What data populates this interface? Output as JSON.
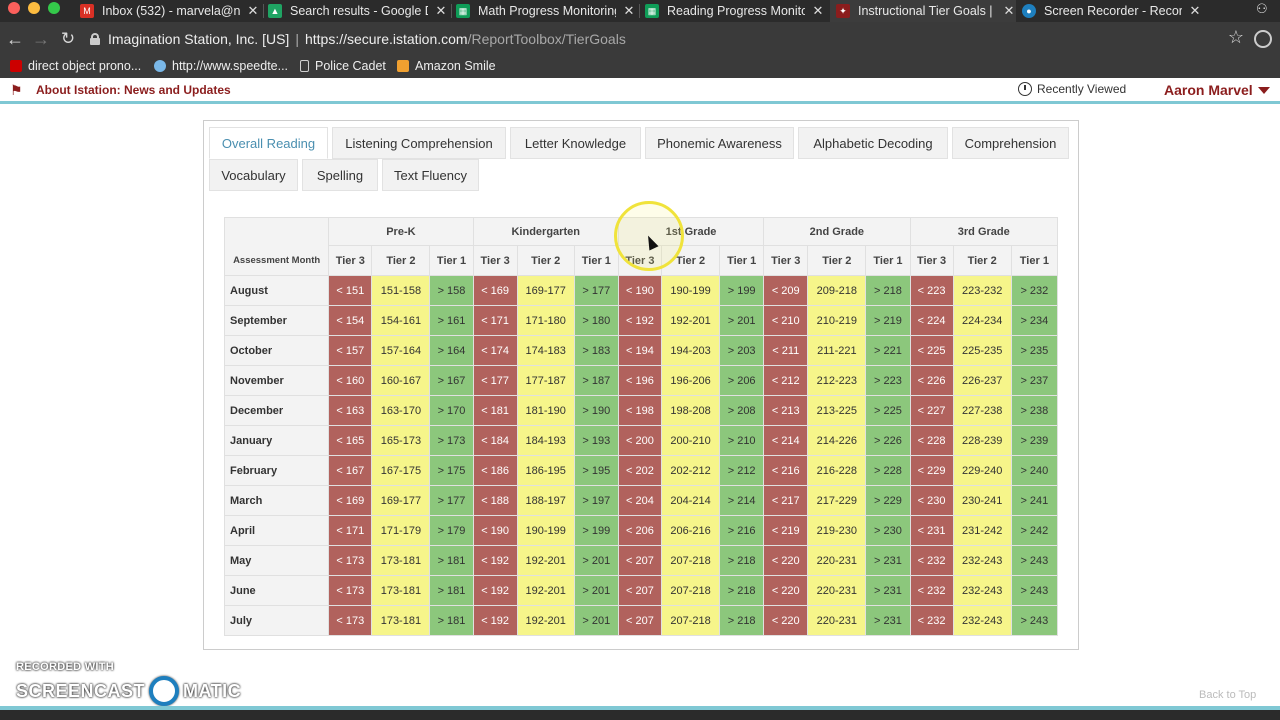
{
  "browser": {
    "tabs": [
      {
        "title": "Inbox (532) - marvela@na",
        "icon": "gmail-icon",
        "color": "#d93025"
      },
      {
        "title": "Search results - Google D",
        "icon": "google-drive-icon",
        "color": "#1fa463"
      },
      {
        "title": "Math Progress Monitoring",
        "icon": "google-sheets-icon",
        "color": "#0f9d58"
      },
      {
        "title": "Reading Progress Monitor",
        "icon": "google-sheets-icon",
        "color": "#0f9d58"
      },
      {
        "title": "Instructional Tier Goals | ",
        "icon": "istation-icon",
        "color": "#8b1d1d"
      },
      {
        "title": "Screen Recorder - Record",
        "icon": "screen-recorder-icon",
        "color": "#1e7fbe"
      }
    ],
    "address": {
      "site": "Imagination Station, Inc. [US]",
      "url_host": "https://secure.istation.com",
      "url_path": "/ReportToolbox/TierGoals"
    },
    "bookmarks": [
      {
        "label": "direct object prono...",
        "color": "#cc0000"
      },
      {
        "label": "http://www.speedte...",
        "color": "#7ab8e8"
      },
      {
        "label": "Police Cadet",
        "color": "#cfcfcf"
      },
      {
        "label": "Amazon Smile",
        "color": "#f0a030"
      }
    ]
  },
  "site_header": {
    "news_link": "About Istation: News and Updates",
    "recently_viewed": "Recently Viewed",
    "user_name": "Aaron Marvel",
    "brand_color": "#8b1d1d"
  },
  "report_tabs": [
    "Overall Reading",
    "Listening Comprehension",
    "Letter Knowledge",
    "Phonemic Awareness",
    "Alphabetic Decoding",
    "Comprehension",
    "Vocabulary",
    "Spelling",
    "Text Fluency"
  ],
  "active_tab": "Overall Reading",
  "table": {
    "month_header": "Assessment Month",
    "grades": [
      "Pre-K",
      "Kindergarten",
      "1st Grade",
      "2nd Grade",
      "3rd Grade"
    ],
    "tiers": [
      "Tier 3",
      "Tier 2",
      "Tier 1"
    ],
    "colors": {
      "tier3": "#b1625d",
      "tier2": "#f6f58a",
      "tier1": "#8cc77c"
    },
    "rows": [
      {
        "month": "August",
        "cells": [
          "< 151",
          "151-158",
          "> 158",
          "< 169",
          "169-177",
          "> 177",
          "< 190",
          "190-199",
          "> 199",
          "< 209",
          "209-218",
          "> 218",
          "< 223",
          "223-232",
          "> 232"
        ]
      },
      {
        "month": "September",
        "cells": [
          "< 154",
          "154-161",
          "> 161",
          "< 171",
          "171-180",
          "> 180",
          "< 192",
          "192-201",
          "> 201",
          "< 210",
          "210-219",
          "> 219",
          "< 224",
          "224-234",
          "> 234"
        ]
      },
      {
        "month": "October",
        "cells": [
          "< 157",
          "157-164",
          "> 164",
          "< 174",
          "174-183",
          "> 183",
          "< 194",
          "194-203",
          "> 203",
          "< 211",
          "211-221",
          "> 221",
          "< 225",
          "225-235",
          "> 235"
        ]
      },
      {
        "month": "November",
        "cells": [
          "< 160",
          "160-167",
          "> 167",
          "< 177",
          "177-187",
          "> 187",
          "< 196",
          "196-206",
          "> 206",
          "< 212",
          "212-223",
          "> 223",
          "< 226",
          "226-237",
          "> 237"
        ]
      },
      {
        "month": "December",
        "cells": [
          "< 163",
          "163-170",
          "> 170",
          "< 181",
          "181-190",
          "> 190",
          "< 198",
          "198-208",
          "> 208",
          "< 213",
          "213-225",
          "> 225",
          "< 227",
          "227-238",
          "> 238"
        ]
      },
      {
        "month": "January",
        "cells": [
          "< 165",
          "165-173",
          "> 173",
          "< 184",
          "184-193",
          "> 193",
          "< 200",
          "200-210",
          "> 210",
          "< 214",
          "214-226",
          "> 226",
          "< 228",
          "228-239",
          "> 239"
        ]
      },
      {
        "month": "February",
        "cells": [
          "< 167",
          "167-175",
          "> 175",
          "< 186",
          "186-195",
          "> 195",
          "< 202",
          "202-212",
          "> 212",
          "< 216",
          "216-228",
          "> 228",
          "< 229",
          "229-240",
          "> 240"
        ]
      },
      {
        "month": "March",
        "cells": [
          "< 169",
          "169-177",
          "> 177",
          "< 188",
          "188-197",
          "> 197",
          "< 204",
          "204-214",
          "> 214",
          "< 217",
          "217-229",
          "> 229",
          "< 230",
          "230-241",
          "> 241"
        ]
      },
      {
        "month": "April",
        "cells": [
          "< 171",
          "171-179",
          "> 179",
          "< 190",
          "190-199",
          "> 199",
          "< 206",
          "206-216",
          "> 216",
          "< 219",
          "219-230",
          "> 230",
          "< 231",
          "231-242",
          "> 242"
        ]
      },
      {
        "month": "May",
        "cells": [
          "< 173",
          "173-181",
          "> 181",
          "< 192",
          "192-201",
          "> 201",
          "< 207",
          "207-218",
          "> 218",
          "< 220",
          "220-231",
          "> 231",
          "< 232",
          "232-243",
          "> 243"
        ]
      },
      {
        "month": "June",
        "cells": [
          "< 173",
          "173-181",
          "> 181",
          "< 192",
          "192-201",
          "> 201",
          "< 207",
          "207-218",
          "> 218",
          "< 220",
          "220-231",
          "> 231",
          "< 232",
          "232-243",
          "> 243"
        ]
      },
      {
        "month": "July",
        "cells": [
          "< 173",
          "173-181",
          "> 181",
          "< 192",
          "192-201",
          "> 201",
          "< 207",
          "207-218",
          "> 218",
          "< 220",
          "220-231",
          "> 231",
          "< 232",
          "232-243",
          "> 243"
        ]
      }
    ]
  },
  "watermark": {
    "line1": "RECORDED WITH",
    "left": "SCREENCAST",
    "right": "MATIC"
  },
  "back_to_top": "Back to Top"
}
